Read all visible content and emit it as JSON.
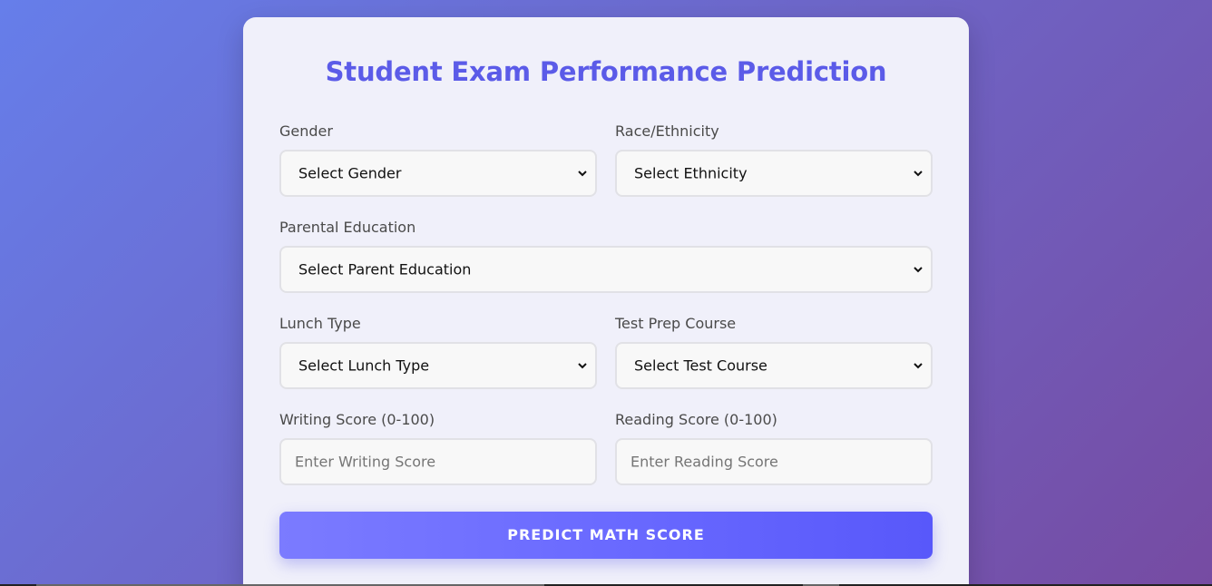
{
  "form": {
    "title": "Student Exam Performance Prediction",
    "fields": {
      "gender": {
        "label": "Gender",
        "value": "Select Gender"
      },
      "ethnicity": {
        "label": "Race/Ethnicity",
        "value": "Select Ethnicity"
      },
      "parental_education": {
        "label": "Parental Education",
        "value": "Select Parent Education"
      },
      "lunch": {
        "label": "Lunch Type",
        "value": "Select Lunch Type"
      },
      "test_prep": {
        "label": "Test Prep Course",
        "value": "Select Test Course"
      },
      "writing_score": {
        "label": "Writing Score (0-100)",
        "placeholder": "Enter Writing Score"
      },
      "reading_score": {
        "label": "Reading Score (0-100)",
        "placeholder": "Enter Reading Score"
      }
    },
    "submit_label": "PREDICT MATH SCORE"
  },
  "colors": {
    "background_start": "#667eea",
    "background_end": "#764ba2",
    "accent": "#5b5be8",
    "card": "#f0f0fa"
  }
}
